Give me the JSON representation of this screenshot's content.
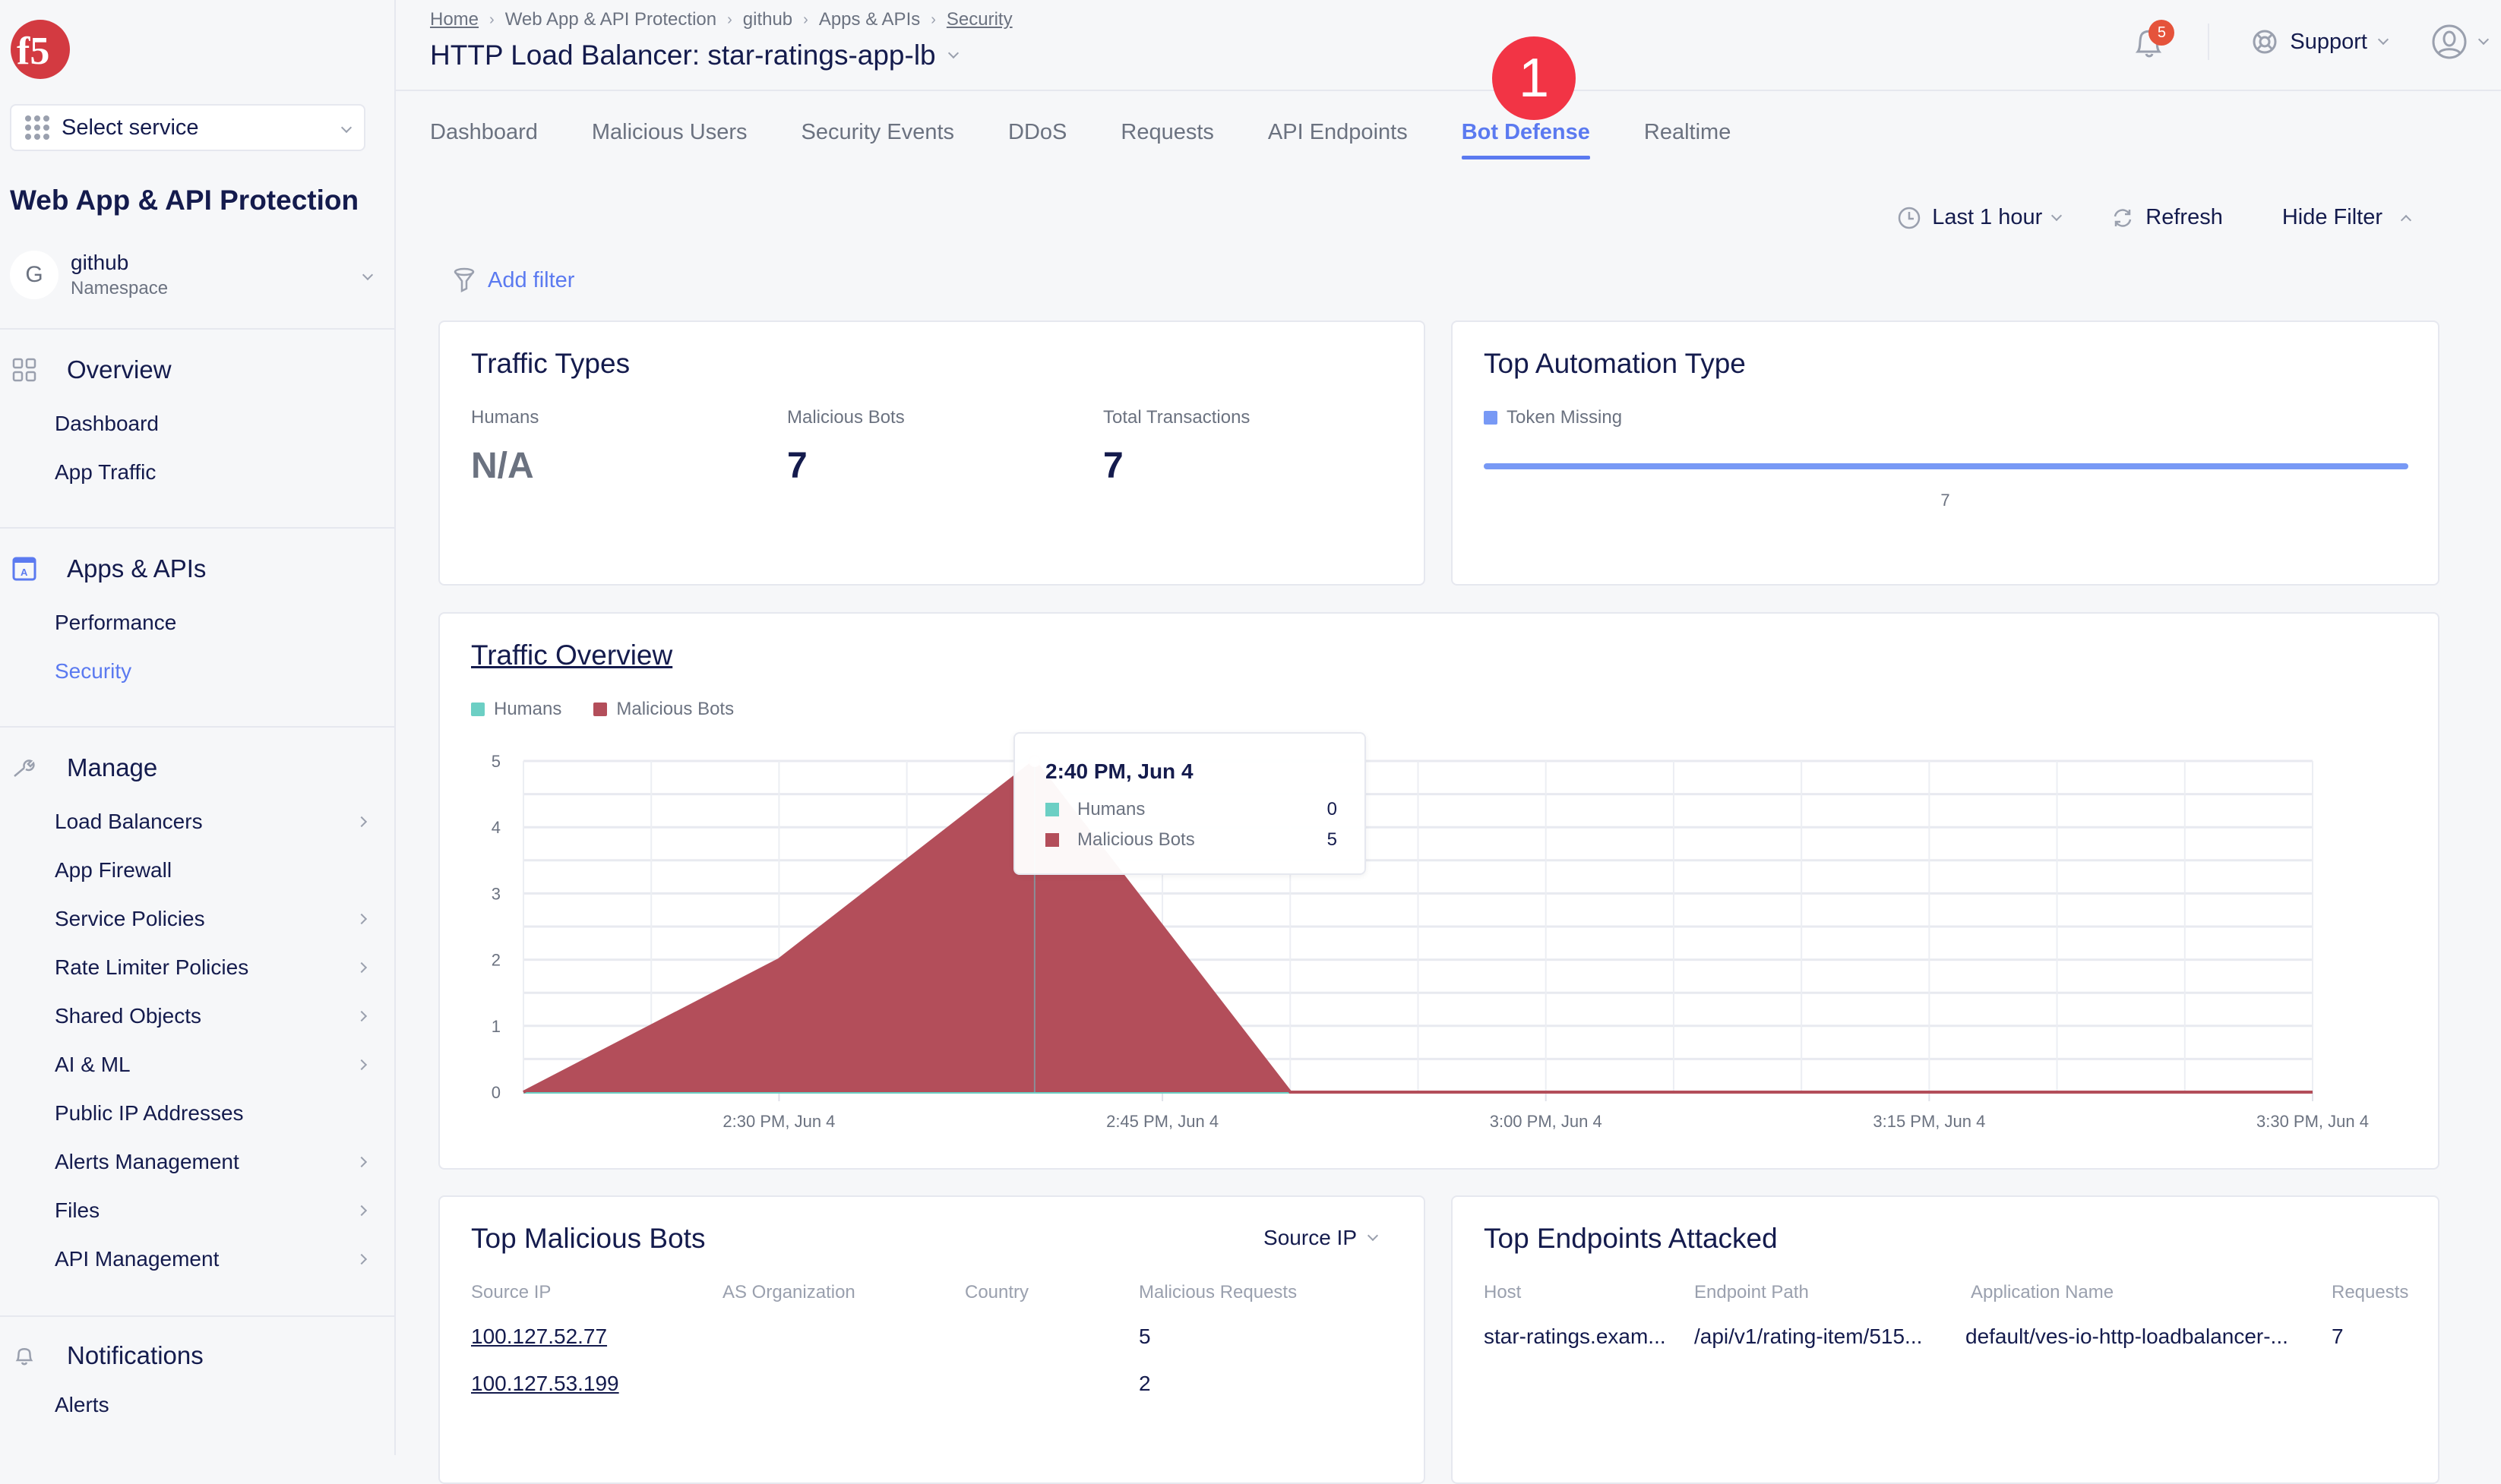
{
  "sidebar": {
    "select_service_label": "Select service",
    "product_title": "Web App & API Protection",
    "namespace": {
      "avatar_letter": "G",
      "name": "github",
      "sub": "Namespace"
    },
    "sections": [
      {
        "title": "Overview",
        "icon": "grid-icon",
        "items": [
          {
            "label": "Dashboard",
            "has_chevron": false
          },
          {
            "label": "App Traffic",
            "has_chevron": false
          }
        ]
      },
      {
        "title": "Apps & APIs",
        "icon": "app-icon",
        "items": [
          {
            "label": "Performance",
            "has_chevron": false
          },
          {
            "label": "Security",
            "has_chevron": false,
            "active": true
          }
        ]
      },
      {
        "title": "Manage",
        "icon": "wrench-icon",
        "items": [
          {
            "label": "Load Balancers",
            "has_chevron": true
          },
          {
            "label": "App Firewall",
            "has_chevron": false
          },
          {
            "label": "Service Policies",
            "has_chevron": true
          },
          {
            "label": "Rate Limiter Policies",
            "has_chevron": true
          },
          {
            "label": "Shared Objects",
            "has_chevron": true
          },
          {
            "label": "AI & ML",
            "has_chevron": true
          },
          {
            "label": "Public IP Addresses",
            "has_chevron": false
          },
          {
            "label": "Alerts Management",
            "has_chevron": true
          },
          {
            "label": "Files",
            "has_chevron": true
          },
          {
            "label": "API Management",
            "has_chevron": true
          }
        ]
      },
      {
        "title": "Notifications",
        "icon": "bell-icon",
        "items": [
          {
            "label": "Alerts",
            "has_chevron": false
          }
        ]
      }
    ]
  },
  "header": {
    "breadcrumb": [
      "Home",
      "Web App & API Protection",
      "github",
      "Apps & APIs",
      "Security"
    ],
    "title": "HTTP Load Balancer: star-ratings-app-lb",
    "notifications_count": "5",
    "support_label": "Support"
  },
  "tabs": [
    "Dashboard",
    "Malicious Users",
    "Security Events",
    "DDoS",
    "Requests",
    "API Endpoints",
    "Bot Defense",
    "Realtime"
  ],
  "active_tab": "Bot Defense",
  "step_badge": "1",
  "filters": {
    "time_range": "Last 1 hour",
    "refresh_label": "Refresh",
    "hide_filter_label": "Hide Filter",
    "add_filter_label": "Add filter"
  },
  "traffic_types": {
    "title": "Traffic Types",
    "stats": [
      {
        "label": "Humans",
        "value": "N/A"
      },
      {
        "label": "Malicious Bots",
        "value": "7"
      },
      {
        "label": "Total Transactions",
        "value": "7"
      }
    ]
  },
  "top_automation": {
    "title": "Top Automation Type",
    "legend": "Token Missing",
    "value": "7",
    "fraction": 1.0,
    "color": "#7899f5"
  },
  "chart_data": {
    "type": "area",
    "title": "Traffic Overview",
    "xlabel": "",
    "ylabel": "",
    "x": [
      "2:20 PM",
      "2:25 PM",
      "2:30 PM",
      "2:35 PM",
      "2:40 PM",
      "2:45 PM",
      "2:50 PM",
      "2:55 PM",
      "3:00 PM",
      "3:05 PM",
      "3:10 PM",
      "3:15 PM",
      "3:20 PM",
      "3:25 PM",
      "3:30 PM"
    ],
    "x_tick_labels": [
      "2:30 PM, Jun 4",
      "2:45 PM, Jun 4",
      "3:00 PM, Jun 4",
      "3:15 PM, Jun 4",
      "3:30 PM, Jun 4"
    ],
    "x_tick_indices": [
      2,
      5,
      8,
      11,
      14
    ],
    "y_ticks": [
      0,
      1,
      2,
      3,
      4,
      5
    ],
    "ylim": [
      0,
      5
    ],
    "grid": true,
    "legend_position": "top-left",
    "series": [
      {
        "name": "Humans",
        "color": "#6ccfc4",
        "values": [
          0,
          0,
          0,
          0,
          0,
          0,
          0,
          0,
          0,
          0,
          0,
          0,
          0,
          0,
          0
        ]
      },
      {
        "name": "Malicious Bots",
        "color": "#b34e5a",
        "values": [
          0,
          null,
          2,
          null,
          5,
          null,
          0,
          0,
          0,
          0,
          0,
          0,
          0,
          0,
          0
        ]
      }
    ],
    "tooltip": {
      "title": "2:40 PM, Jun 4",
      "rows": [
        {
          "name": "Humans",
          "value": "0",
          "color": "#6ccfc4"
        },
        {
          "name": "Malicious Bots",
          "value": "5",
          "color": "#b34e5a"
        }
      ]
    }
  },
  "top_bots": {
    "title": "Top Malicious Bots",
    "group_by": "Source IP",
    "columns": [
      "Source IP",
      "AS Organization",
      "Country",
      "Malicious Requests"
    ],
    "rows": [
      {
        "source_ip": "100.127.52.77",
        "as_org": "",
        "country": "",
        "requests": "5"
      },
      {
        "source_ip": "100.127.53.199",
        "as_org": "",
        "country": "",
        "requests": "2"
      }
    ]
  },
  "top_endpoints": {
    "title": "Top Endpoints Attacked",
    "columns": [
      "Host",
      "Endpoint Path",
      "Application Name",
      "Requests"
    ],
    "rows": [
      {
        "host": "star-ratings.exam...",
        "path": "/api/v1/rating-item/515...",
        "app": "default/ves-io-http-loadbalancer-...",
        "requests": "7"
      }
    ]
  }
}
